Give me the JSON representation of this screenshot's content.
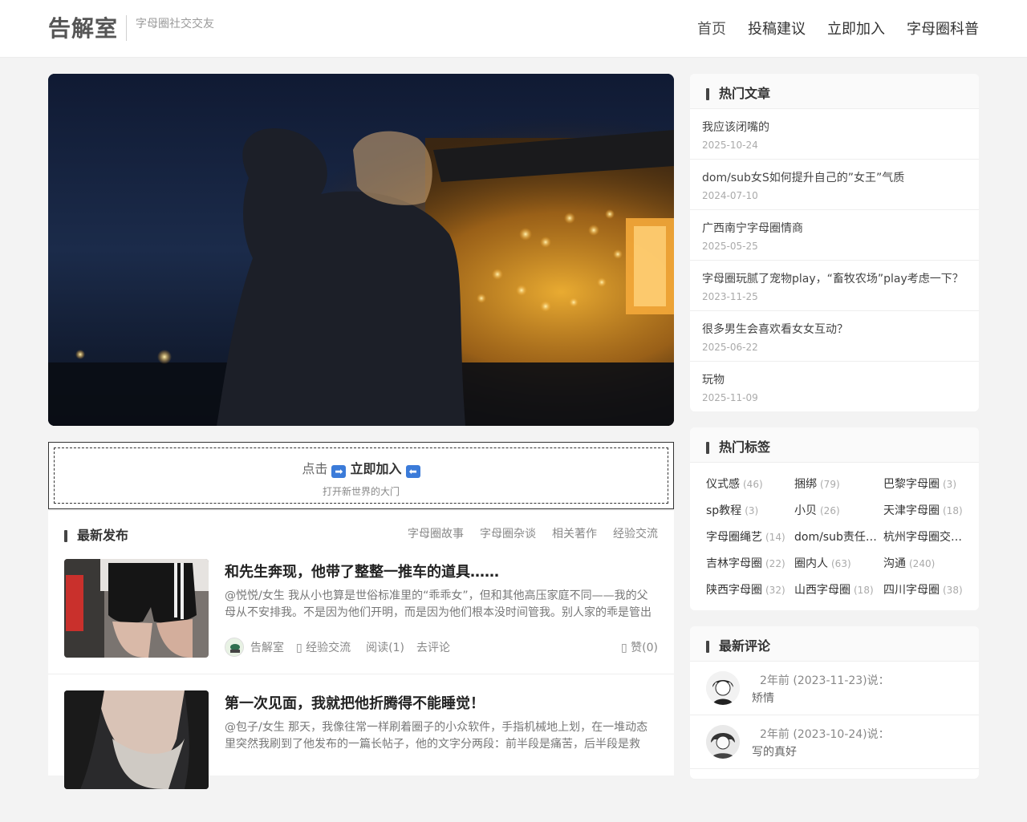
{
  "header": {
    "logo": "告解室",
    "tagline": "字母圈社交交友",
    "nav": [
      {
        "label": "首页"
      },
      {
        "label": "投稿建议"
      },
      {
        "label": "立即加入"
      },
      {
        "label": "字母圈科普"
      }
    ]
  },
  "cta": {
    "prefix": "点击",
    "arrow_right": "➡",
    "main": "立即加入",
    "arrow_left": "⬅",
    "subtitle": "打开新世界的大门"
  },
  "latest": {
    "title": "最新发布",
    "categories": [
      "字母圈故事",
      "字母圈杂谈",
      "相关著作",
      "经验交流"
    ],
    "posts": [
      {
        "title": "和先生奔现，他带了整整一推车的道具……",
        "excerpt": "@悦悦/女生 我从小也算是世俗标准里的“乖乖女”，但和其他高压家庭不同——我的父母从不安排我。不是因为他们开明，而是因为他们根本没时间管我。别人家的乖是管出来的……",
        "author": "告解室",
        "category": "经验交流",
        "reads": "阅读(1)",
        "comment": "去评论",
        "likes": "赞(0)"
      },
      {
        "title": "第一次见面，我就把他折腾得不能睡觉！",
        "excerpt": "@包子/女生 那天，我像往常一样刷着圈子的小众软件，手指机械地上划，在一堆动态里突然我刷到了他发布的一篇长帖子，他的文字分两段：前半段是痛苦，后半段是救赎……"
      }
    ]
  },
  "sidebar": {
    "hot_articles": {
      "title": "热门文章",
      "items": [
        {
          "title": "我应该闭嘴的",
          "date": "2025-10-24"
        },
        {
          "title": "dom/sub女S如何提升自己的”女王”气质",
          "date": "2024-07-10"
        },
        {
          "title": "广西南宁字母圈情商",
          "date": "2025-05-25"
        },
        {
          "title": "字母圈玩腻了宠物play，“畜牧农场”play考虑一下？",
          "date": "2023-11-25"
        },
        {
          "title": "很多男生会喜欢看女女互动？",
          "date": "2025-06-22"
        },
        {
          "title": "玩物",
          "date": "2025-11-09"
        }
      ]
    },
    "hot_tags": {
      "title": "热门标签",
      "items": [
        {
          "name": "仪式感",
          "count": "(46)"
        },
        {
          "name": "捆绑",
          "count": "(79)"
        },
        {
          "name": "巴黎字母圈",
          "count": "(3)"
        },
        {
          "name": "sp教程",
          "count": "(3)"
        },
        {
          "name": "小贝",
          "count": "(26)"
        },
        {
          "name": "天津字母圈",
          "count": "(18)"
        },
        {
          "name": "字母圈绳艺",
          "count": "(14)"
        },
        {
          "name": "dom/sub责任…",
          "count": ""
        },
        {
          "name": "杭州字母圈交…",
          "count": ""
        },
        {
          "name": "吉林字母圈",
          "count": "(22)"
        },
        {
          "name": "圈内人",
          "count": "(63)"
        },
        {
          "name": "沟通",
          "count": "(240)"
        },
        {
          "name": "陕西字母圈",
          "count": "(32)"
        },
        {
          "name": "山西字母圈",
          "count": "(18)"
        },
        {
          "name": "四川字母圈",
          "count": "(38)"
        }
      ]
    },
    "latest_comments": {
      "title": "最新评论",
      "items": [
        {
          "meta": "2年前 (2023-11-23)说：",
          "text": "矫情"
        },
        {
          "meta": "2年前 (2023-10-24)说：",
          "text": "写的真好"
        }
      ]
    }
  }
}
